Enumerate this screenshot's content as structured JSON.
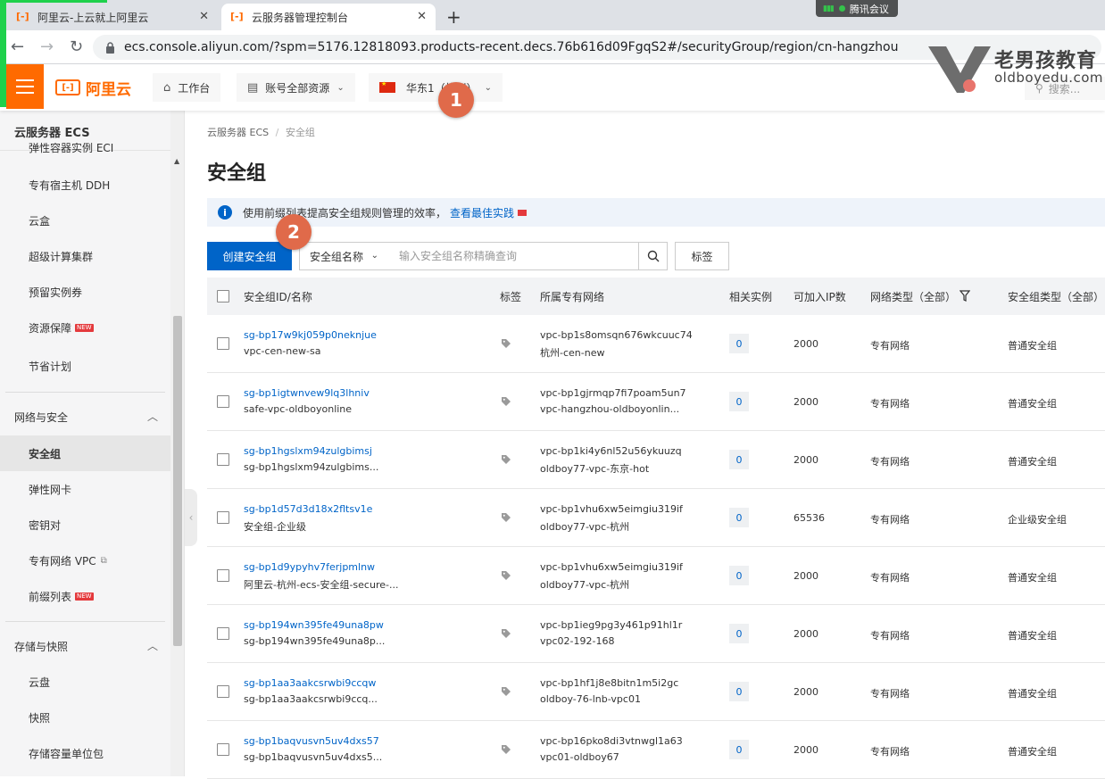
{
  "browser": {
    "tabs": [
      {
        "title": "阿里云-上云就上阿里云",
        "favicon": "aliyun-icon"
      },
      {
        "title": "云服务器管理控制台",
        "favicon": "aliyun-icon"
      }
    ],
    "url": "ecs.console.aliyun.com/?spm=5176.12818093.products-recent.decs.76b616d09FgqS2#/securityGroup/region/cn-hangzhou",
    "meeting_label": "腾讯会议"
  },
  "watermark": {
    "brand": "老男孩教育",
    "site": "oldboyedu.com"
  },
  "header": {
    "logo_text": "阿里云",
    "workbench": "工作台",
    "account": "账号全部资源",
    "region": "华东1（杭州）",
    "search_placeholder": "搜索..."
  },
  "annotations": [
    "1",
    "2"
  ],
  "sidebar": {
    "title": "云服务器 ECS",
    "clipped_item": "弹性容器实例 ECI",
    "items": [
      {
        "label": "专有宿主机 DDH"
      },
      {
        "label": "云盒"
      },
      {
        "label": "超级计算集群"
      },
      {
        "label": "预留实例券"
      },
      {
        "label": "资源保障",
        "new": "NEW"
      },
      {
        "label": "节省计划"
      }
    ],
    "group_network": "网络与安全",
    "network_items": [
      {
        "label": "安全组",
        "selected": true
      },
      {
        "label": "弹性网卡"
      },
      {
        "label": "密钥对"
      },
      {
        "label": "专有网络 VPC",
        "external": true
      },
      {
        "label": "前缀列表",
        "new": "NEW"
      }
    ],
    "group_storage": "存储与快照",
    "storage_items": [
      {
        "label": "云盘"
      },
      {
        "label": "快照"
      },
      {
        "label": "存储容量单位包"
      }
    ]
  },
  "breadcrumb": {
    "root": "云服务器 ECS",
    "sep": "/",
    "current": "安全组"
  },
  "page_title": "安全组",
  "notice": {
    "text": "使用前缀列表提高安全组规则管理的效率，",
    "link": "查看最佳实践"
  },
  "toolbar": {
    "create_label": "创建安全组",
    "filter_label": "安全组名称",
    "search_placeholder": "输入安全组名称精确查询",
    "tag_label": "标签"
  },
  "table": {
    "headers": {
      "id_name": "安全组ID/名称",
      "tag": "标签",
      "vpc": "所属专有网络",
      "instances": "相关实例",
      "ips": "可加入IP数",
      "net_type": "网络类型（全部）",
      "sg_type": "安全组类型（全部）"
    },
    "rows": [
      {
        "id": "sg-bp17w9kj059p0neknjue",
        "name": "vpc-cen-new-sa",
        "vpc_id": "vpc-bp1s8omsqn676wkcuuc74",
        "vpc_name": "杭州-cen-new",
        "instances": "0",
        "ips": "2000",
        "net_type": "专有网络",
        "sg_type": "普通安全组"
      },
      {
        "id": "sg-bp1igtwnvew9lq3lhniv",
        "name": "safe-vpc-oldboyonline",
        "vpc_id": "vpc-bp1gjrmqp7fi7poam5un7",
        "vpc_name": "vpc-hangzhou-oldboyonlin...",
        "instances": "0",
        "ips": "2000",
        "net_type": "专有网络",
        "sg_type": "普通安全组"
      },
      {
        "id": "sg-bp1hgslxm94zulgbimsj",
        "name": "sg-bp1hgslxm94zulgbims...",
        "vpc_id": "vpc-bp1ki4y6nl52u56ykuuzq",
        "vpc_name": "oldboy77-vpc-东京-hot",
        "instances": "0",
        "ips": "2000",
        "net_type": "专有网络",
        "sg_type": "普通安全组"
      },
      {
        "id": "sg-bp1d57d3d18x2fltsv1e",
        "name": "安全组-企业级",
        "vpc_id": "vpc-bp1vhu6xw5eimgiu319if",
        "vpc_name": "oldboy77-vpc-杭州",
        "instances": "0",
        "ips": "65536",
        "net_type": "专有网络",
        "sg_type": "企业级安全组"
      },
      {
        "id": "sg-bp1d9ypyhv7ferjpmlnw",
        "name": "阿里云-杭州-ecs-安全组-secure-...",
        "vpc_id": "vpc-bp1vhu6xw5eimgiu319if",
        "vpc_name": "oldboy77-vpc-杭州",
        "instances": "0",
        "ips": "2000",
        "net_type": "专有网络",
        "sg_type": "普通安全组"
      },
      {
        "id": "sg-bp194wn395fe49una8pw",
        "name": "sg-bp194wn395fe49una8p...",
        "vpc_id": "vpc-bp1ieg9pg3y461p91hl1r",
        "vpc_name": "vpc02-192-168",
        "instances": "0",
        "ips": "2000",
        "net_type": "专有网络",
        "sg_type": "普通安全组"
      },
      {
        "id": "sg-bp1aa3aakcsrwbi9ccqw",
        "name": "sg-bp1aa3aakcsrwbi9ccq...",
        "vpc_id": "vpc-bp1hf1j8e8bitn1m5i2gc",
        "vpc_name": "oldboy-76-lnb-vpc01",
        "instances": "0",
        "ips": "2000",
        "net_type": "专有网络",
        "sg_type": "普通安全组"
      },
      {
        "id": "sg-bp1baqvusvn5uv4dxs57",
        "name": "sg-bp1baqvusvn5uv4dxs5...",
        "vpc_id": "vpc-bp16pko8di3vtnwgl1a63",
        "vpc_name": "vpc01-oldboy67",
        "instances": "0",
        "ips": "2000",
        "net_type": "专有网络",
        "sg_type": "普通安全组"
      }
    ]
  },
  "colors": {
    "brand": "#ff6a00",
    "primary": "#0064c8",
    "annotation": "#e06a4a"
  }
}
